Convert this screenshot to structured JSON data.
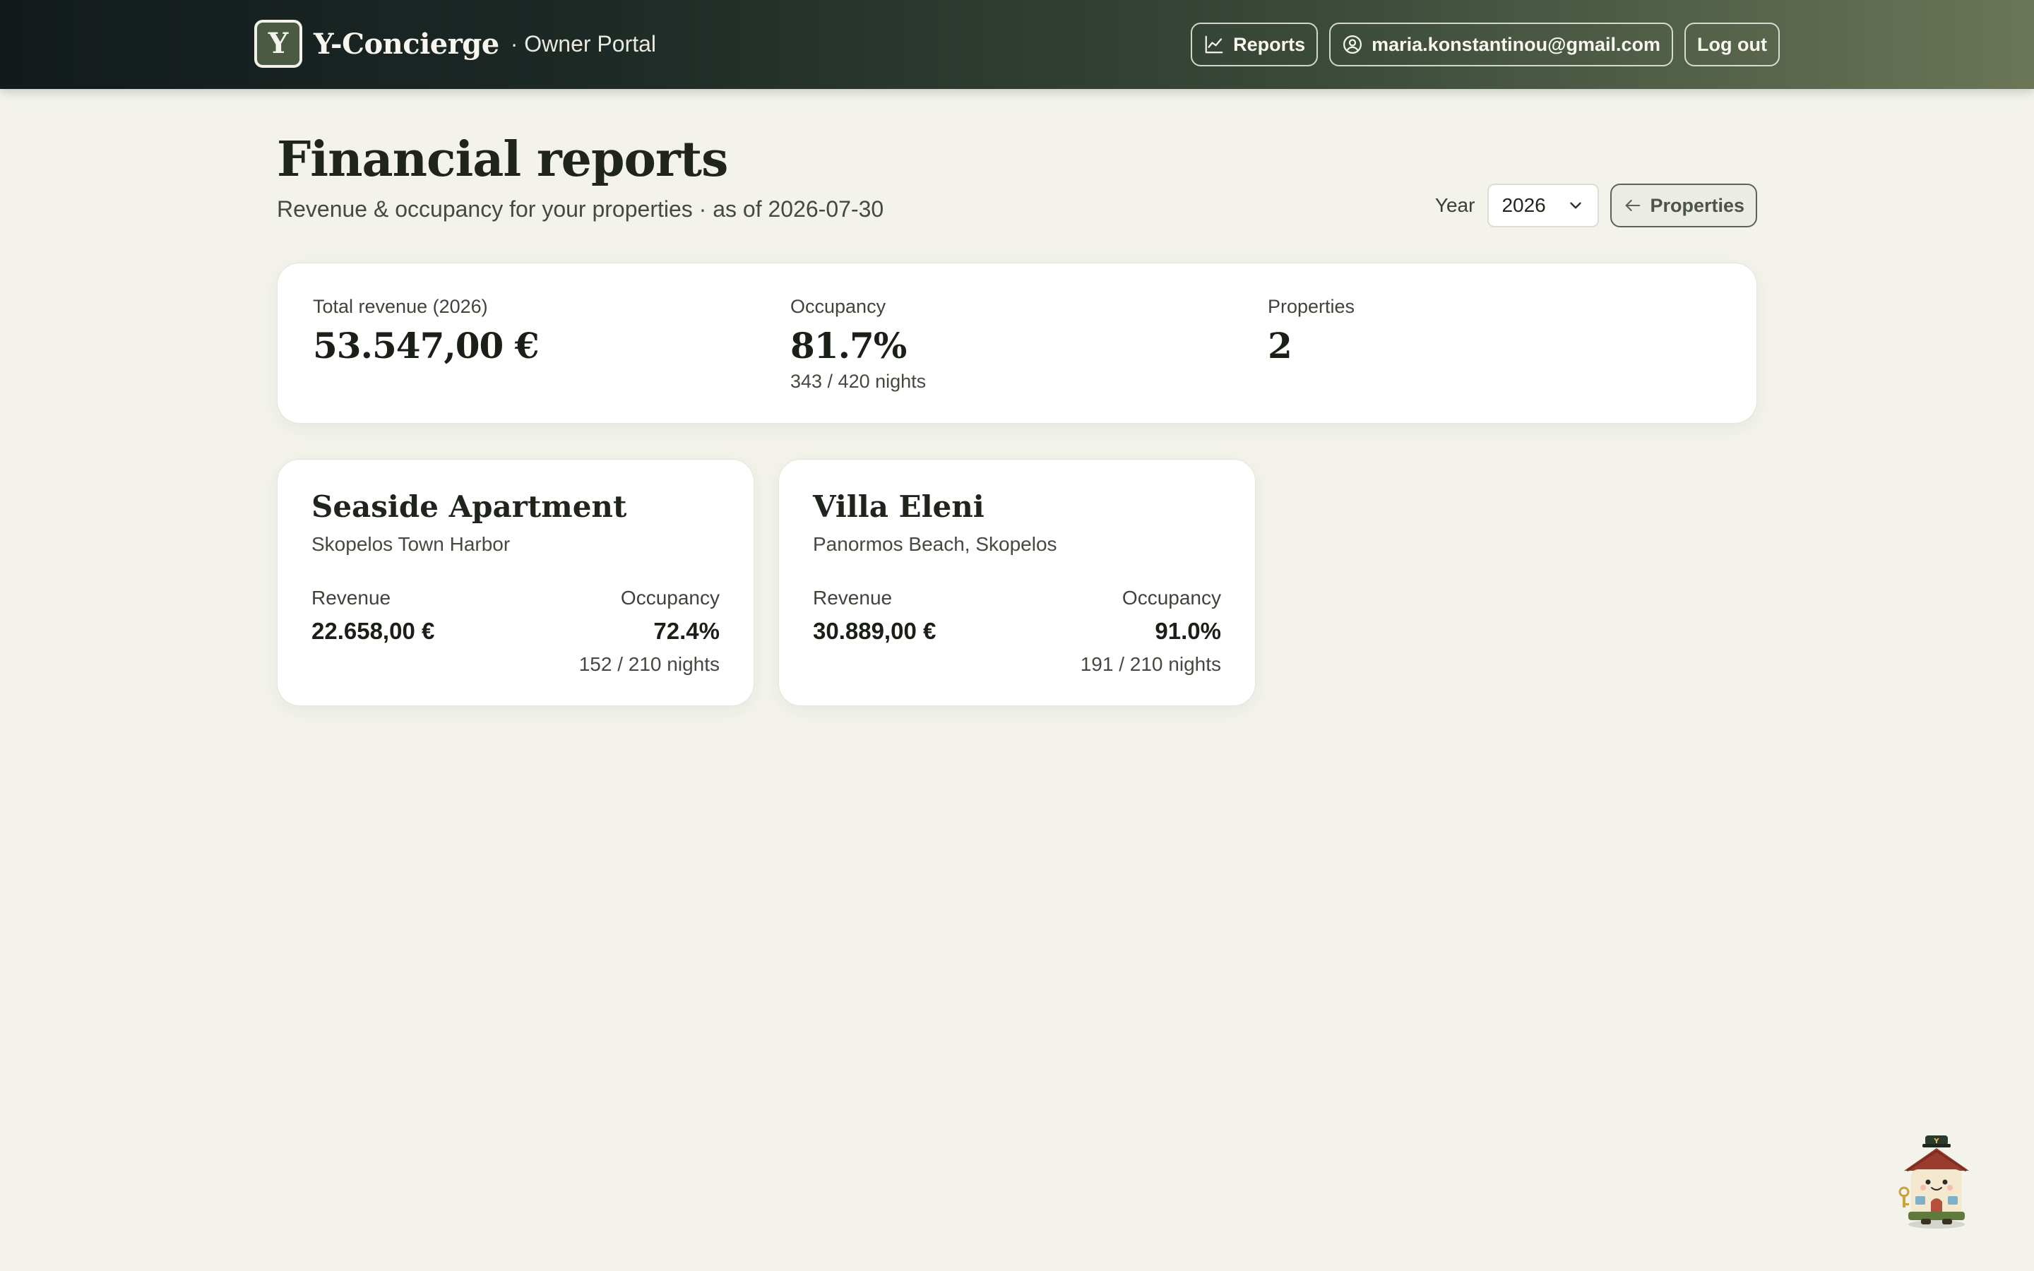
{
  "header": {
    "logo_letter": "Y",
    "brand": "Y-Concierge",
    "portal": "· Owner Portal",
    "nav": {
      "reports": "Reports",
      "account": "maria.konstantinou@gmail.com",
      "logout": "Log out"
    }
  },
  "page": {
    "title": "Financial reports",
    "subtitle": "Revenue & occupancy for your properties · as of 2026-07-30",
    "year_label": "Year",
    "year_value": "2026",
    "back_label": "Properties"
  },
  "summary": {
    "revenue_label": "Total revenue (2026)",
    "revenue_value": "53.547,00 €",
    "occupancy_label": "Occupancy",
    "occupancy_value": "81.7%",
    "occupancy_nights": "343 / 420 nights",
    "properties_label": "Properties",
    "properties_value": "2"
  },
  "properties": [
    {
      "name": "Seaside Apartment",
      "location": "Skopelos Town Harbor",
      "revenue_label": "Revenue",
      "revenue": "22.658,00 €",
      "occupancy_label": "Occupancy",
      "occupancy": "72.4%",
      "nights": "152 / 210 nights"
    },
    {
      "name": "Villa Eleni",
      "location": "Panormos Beach, Skopelos",
      "revenue_label": "Revenue",
      "revenue": "30.889,00 €",
      "occupancy_label": "Occupancy",
      "occupancy": "91.0%",
      "nights": "191 / 210 nights"
    }
  ],
  "mascot": {
    "badge_letter": "Y"
  },
  "icons": {
    "reports": "chart-line-icon",
    "account": "user-circle-icon",
    "select": "chevron-down-icon",
    "back": "arrow-left-icon",
    "mascot": "house-concierge-mascot-icon"
  },
  "colors": {
    "background": "#f3f3ec",
    "header_start": "#121a1c",
    "header_end": "#6a7656",
    "card": "#ffffff",
    "text": "#1f241c"
  }
}
